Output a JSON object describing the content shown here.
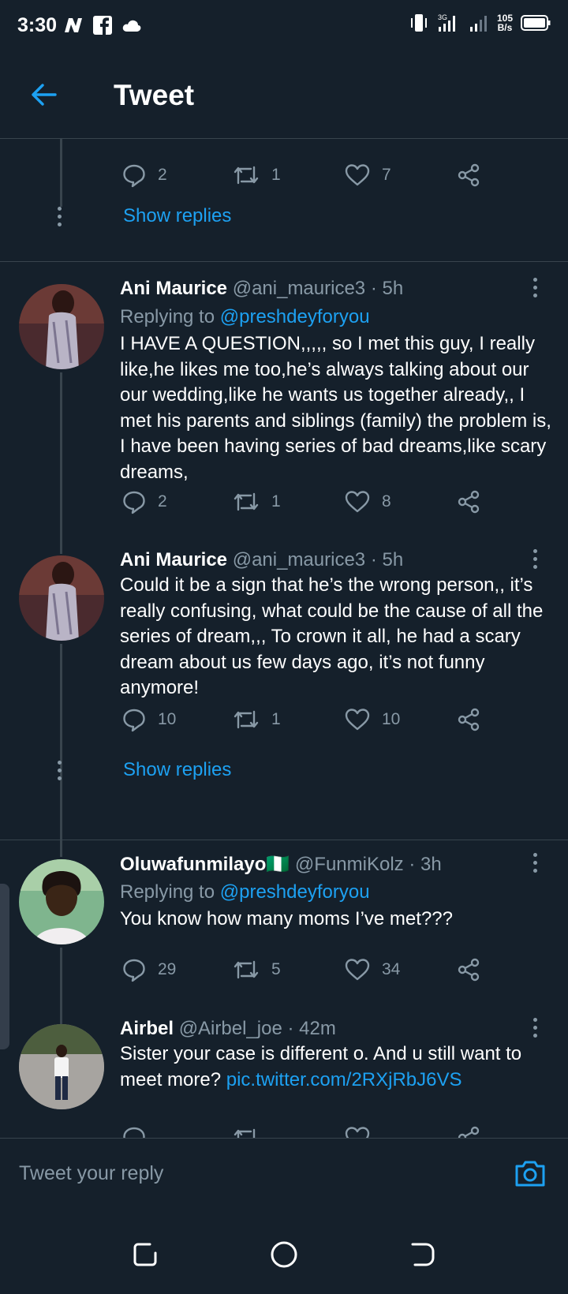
{
  "status_bar": {
    "time": "3:30",
    "net_speed_value": "105",
    "net_speed_unit": "B/s",
    "network": "3G"
  },
  "header": {
    "title": "Tweet"
  },
  "partial_tweet": {
    "replies": "2",
    "retweets": "1",
    "likes": "7"
  },
  "show_replies_label": "Show replies",
  "tweets": [
    {
      "name": "Ani Maurice",
      "handle": "@ani_maurice3",
      "time": "· 5h",
      "replying_to_prefix": "Replying to",
      "replying_to": "@preshdeyforyou",
      "text": "I HAVE A QUESTION,,,,, so I met this guy, I really like,he likes me too,he’s always talking about our our wedding,like he wants us together already,, I met his parents and siblings (family) the problem is, I have been having series of bad dreams,like scary dreams,",
      "replies": "2",
      "retweets": "1",
      "likes": "8"
    },
    {
      "name": "Ani Maurice",
      "handle": "@ani_maurice3",
      "time": "· 5h",
      "text": "Could it be a sign that he’s the wrong person,, it’s really confusing, what could be the cause of all the series of dream,,, To crown it all, he had a scary dream about us few days ago, it’s not funny anymore!",
      "replies": "10",
      "retweets": "1",
      "likes": "10"
    },
    {
      "name": "Oluwafunmilayo",
      "flag": "🇳🇬",
      "handle": "@FunmiKolz",
      "time": "· 3h",
      "replying_to_prefix": "Replying to",
      "replying_to": "@preshdeyforyou",
      "text": "You know how many moms I’ve met???",
      "replies": "29",
      "retweets": "5",
      "likes": "34"
    },
    {
      "name": "Airbel",
      "handle": "@Airbel_joe",
      "time": "· 42m",
      "text": "Sister your case is different o. And u still want to meet more?",
      "link": "pic.twitter.com/2RXjRbJ6VS"
    }
  ],
  "composer": {
    "placeholder": "Tweet your reply"
  },
  "colors": {
    "background": "#15202b",
    "accent": "#1da1f2",
    "secondary_text": "#8899a6",
    "divider": "#38444d"
  },
  "icons": [
    "back-arrow-icon",
    "reply-icon",
    "retweet-icon",
    "like-icon",
    "share-icon",
    "more-icon",
    "camera-icon",
    "recents-icon",
    "home-icon",
    "back-nav-icon"
  ]
}
